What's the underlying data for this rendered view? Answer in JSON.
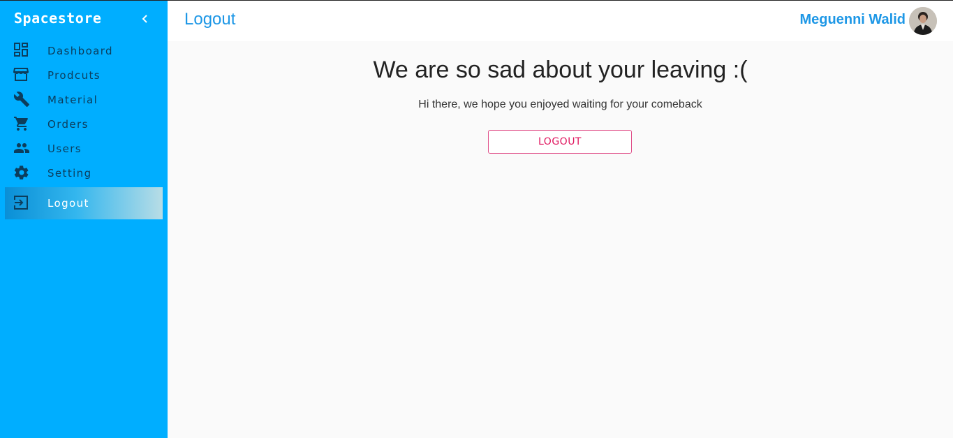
{
  "app": {
    "brand": "Spacestore"
  },
  "sidebar": {
    "items": [
      {
        "label": "Dashboard",
        "icon": "dashboard-icon"
      },
      {
        "label": "Prodcuts",
        "icon": "store-icon"
      },
      {
        "label": "Material",
        "icon": "wrench-icon"
      },
      {
        "label": "Orders",
        "icon": "cart-icon"
      },
      {
        "label": "Users",
        "icon": "users-icon"
      },
      {
        "label": "Setting",
        "icon": "gear-icon"
      },
      {
        "label": "Logout",
        "icon": "logout-icon",
        "active": true
      }
    ]
  },
  "header": {
    "title": "Logout",
    "user_name": "Meguenni Walid"
  },
  "main": {
    "headline": "We are so sad about your leaving :(",
    "message": "Hi there, we hope you enjoyed waiting for your comeback",
    "button_label": "LOGOUT"
  },
  "colors": {
    "sidebar_bg": "#00aeff",
    "accent": "#1d97e6",
    "button": "#e0155e"
  }
}
